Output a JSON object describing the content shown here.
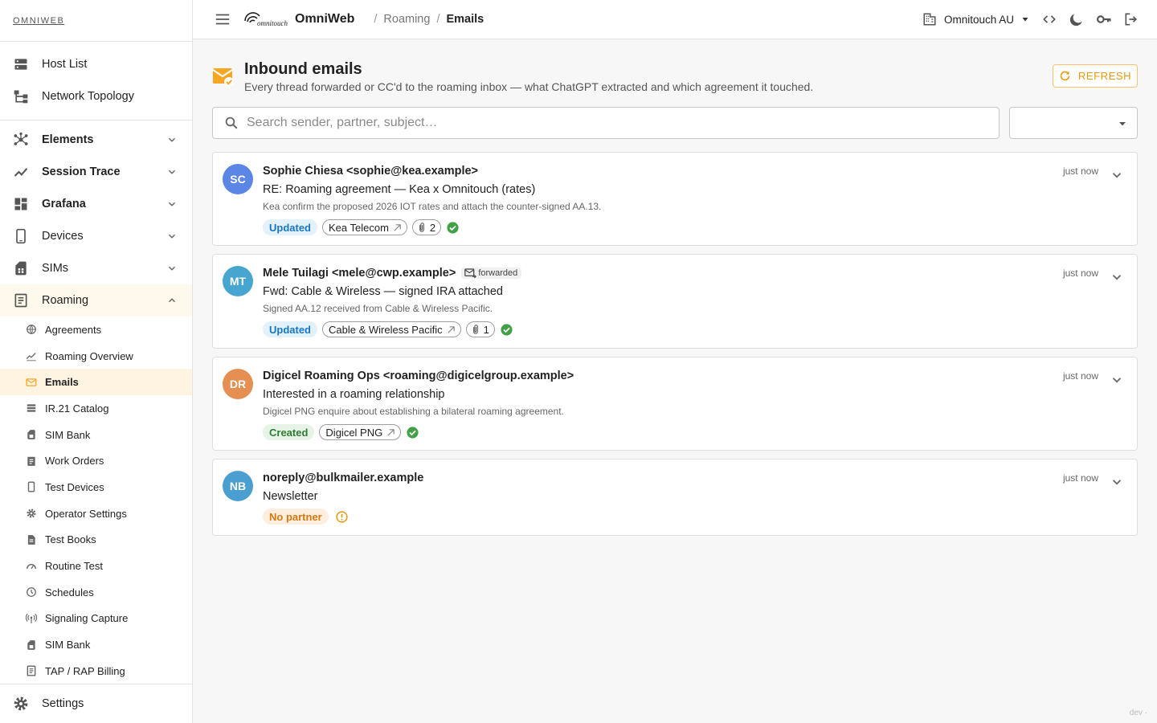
{
  "sidebar": {
    "brand": "OMNIWEB",
    "top_items": [
      {
        "label": "Host List",
        "icon": "dns-icon"
      },
      {
        "label": "Network Topology",
        "icon": "topology-icon"
      }
    ],
    "groups": [
      {
        "label": "Elements",
        "icon": "hub-icon"
      },
      {
        "label": "Session Trace",
        "icon": "trace-icon"
      },
      {
        "label": "Grafana",
        "icon": "dashboard-icon"
      },
      {
        "label": "Devices",
        "icon": "phone-icon"
      },
      {
        "label": "SIMs",
        "icon": "sim-icon"
      }
    ],
    "roaming": {
      "label": "Roaming",
      "icon": "roaming-icon"
    },
    "roaming_items": [
      {
        "label": "Agreements",
        "icon": "globe-icon"
      },
      {
        "label": "Roaming Overview",
        "icon": "trend-icon"
      },
      {
        "label": "Emails",
        "icon": "mail-icon"
      },
      {
        "label": "IR.21 Catalog",
        "icon": "list-icon"
      },
      {
        "label": "SIM Bank",
        "icon": "sim-icon"
      },
      {
        "label": "Work Orders",
        "icon": "clipboard-icon"
      },
      {
        "label": "Test Devices",
        "icon": "phone-icon"
      },
      {
        "label": "Operator Settings",
        "icon": "gear-icon"
      },
      {
        "label": "Test Books",
        "icon": "document-icon"
      },
      {
        "label": "Routine Test",
        "icon": "speed-icon"
      },
      {
        "label": "Schedules",
        "icon": "clock-icon"
      },
      {
        "label": "Signaling Capture",
        "icon": "antenna-icon"
      },
      {
        "label": "SIM Bank",
        "icon": "sim-icon"
      },
      {
        "label": "TAP / RAP Billing",
        "icon": "receipt-icon"
      }
    ],
    "settings": "Settings"
  },
  "topbar": {
    "app_name": "OmniWeb",
    "logo_text": "omnitouch",
    "breadcrumb": [
      "Roaming",
      "Emails"
    ],
    "tenant": "Omnitouch AU"
  },
  "page": {
    "title": "Inbound emails",
    "subtitle": "Every thread forwarded or CC'd to the roaming inbox — what ChatGPT extracted and which agreement it touched.",
    "refresh_label": "REFRESH",
    "search_placeholder": "Search sender, partner, subject…",
    "filter_value": ""
  },
  "emails": [
    {
      "initials": "SC",
      "avatar_color": "#5b86e5",
      "from": "Sophie Chiesa <sophie@kea.example>",
      "forwarded": false,
      "subject": "RE: Roaming agreement — Kea x Omnitouch (rates)",
      "summary": "Kea confirm the proposed 2026 IOT rates and attach the counter-signed AA.13.",
      "time": "just now",
      "status": "Updated",
      "partner": "Kea Telecom",
      "attachments": "2",
      "ok": true
    },
    {
      "initials": "MT",
      "avatar_color": "#46a6cf",
      "from": "Mele Tuilagi <mele@cwp.example>",
      "forwarded": true,
      "forwarded_label": "forwarded",
      "subject": "Fwd: Cable & Wireless — signed IRA attached",
      "summary": "Signed AA.12 received from Cable & Wireless Pacific.",
      "time": "just now",
      "status": "Updated",
      "partner": "Cable & Wireless Pacific",
      "attachments": "1",
      "ok": true
    },
    {
      "initials": "DR",
      "avatar_color": "#e58f52",
      "from": "Digicel Roaming Ops <roaming@digicelgroup.example>",
      "forwarded": false,
      "subject": "Interested in a roaming relationship",
      "summary": "Digicel PNG enquire about establishing a bilateral roaming agreement.",
      "time": "just now",
      "status": "Created",
      "partner": "Digicel PNG",
      "attachments": "",
      "ok": true
    },
    {
      "initials": "NB",
      "avatar_color": "#4b9fd0",
      "from": "noreply@bulkmailer.example",
      "forwarded": false,
      "subject": "Newsletter",
      "summary": "",
      "time": "just now",
      "status": "No partner",
      "partner": "",
      "attachments": "",
      "ok": false
    }
  ],
  "footer_tag": "dev ·",
  "colors": {
    "accent": "#f5a623",
    "active_bg": "#fff4e2",
    "updated": "#1877c2",
    "created": "#2e7d32",
    "no_partner": "#d8770f",
    "ok": "#43a047"
  }
}
